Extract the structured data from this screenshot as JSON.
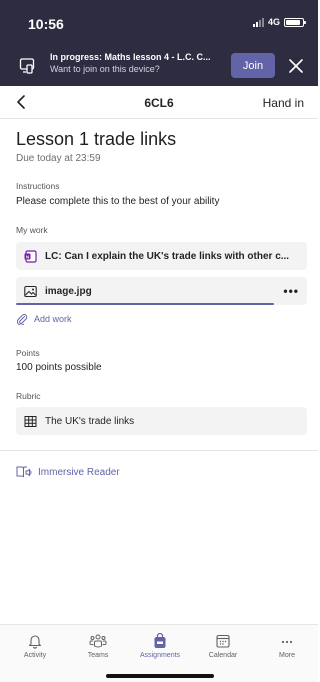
{
  "status_bar": {
    "time": "10:56",
    "network": "4G"
  },
  "banner": {
    "title": "In progress: Maths lesson 4 - L.C. C...",
    "subtitle": "Want to join on this device?",
    "join_label": "Join",
    "icon": "device-icon",
    "close_icon": "close-icon",
    "bg_color": "#2d2c40",
    "join_color": "#6264a7"
  },
  "nav": {
    "title": "6CL6",
    "action": "Hand in",
    "back_icon": "chevron-left-icon"
  },
  "assignment": {
    "title": "Lesson 1 trade links",
    "due": "Due today at 23:59",
    "instructions_label": "Instructions",
    "instructions_text": "Please complete this to the best of your ability",
    "my_work_label": "My work",
    "work_items": [
      {
        "icon": "onenote-icon",
        "text": "LC:  Can I explain the UK's trade links with other c..."
      },
      {
        "icon": "image-icon",
        "text": "image.jpg",
        "menu": "•••"
      }
    ],
    "add_work_label": "Add work",
    "points_label": "Points",
    "points_text": "100 points possible",
    "rubric_label": "Rubric",
    "rubric_item": "The UK's trade links"
  },
  "immersive_reader": "Immersive Reader",
  "tabs": [
    {
      "label": "Activity",
      "icon": "bell-icon",
      "active": false
    },
    {
      "label": "Teams",
      "icon": "teams-icon",
      "active": false
    },
    {
      "label": "Assignments",
      "icon": "assignments-bag-icon",
      "active": true
    },
    {
      "label": "Calendar",
      "icon": "calendar-icon",
      "active": false
    },
    {
      "label": "More",
      "icon": "more-icon",
      "active": false
    }
  ],
  "accent_color": "#6264a7"
}
